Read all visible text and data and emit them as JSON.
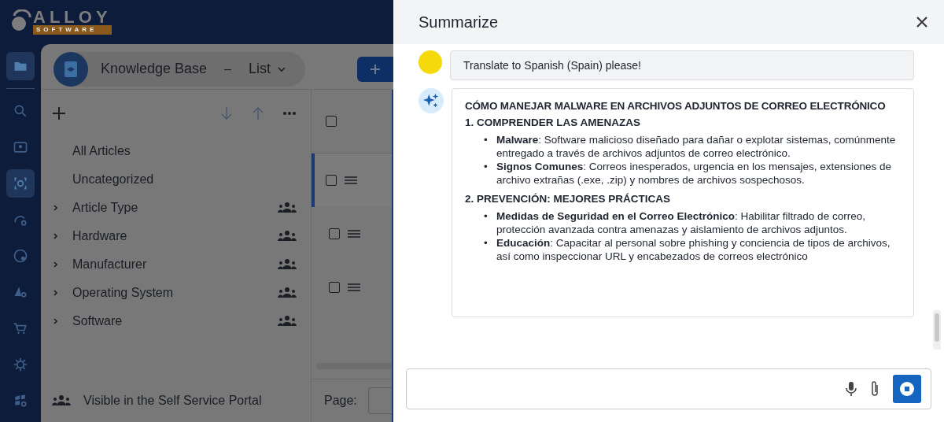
{
  "logo": {
    "word": "ALLOY",
    "tagline": "SOFTWARE"
  },
  "nav": [
    {
      "selected": true
    },
    {
      "selected": false
    },
    {
      "selected": false
    },
    {
      "selected": true
    },
    {
      "selected": false
    },
    {
      "selected": false
    },
    {
      "selected": false
    },
    {
      "selected": false
    },
    {
      "selected": false
    },
    {
      "selected": false
    }
  ],
  "module": {
    "title": "Knowledge Base",
    "separator": "–",
    "view": "List"
  },
  "tree": [
    {
      "kind": "leaf",
      "label": "All Articles"
    },
    {
      "kind": "leaf",
      "label": "Uncategorized"
    },
    {
      "kind": "folder",
      "label": "Article Type",
      "expanded": false
    },
    {
      "kind": "folder",
      "label": "Hardware",
      "expanded": false
    },
    {
      "kind": "folder",
      "label": "Manufacturer",
      "expanded": false
    },
    {
      "kind": "folder",
      "label": "Operating System",
      "expanded": false
    },
    {
      "kind": "folder",
      "label": "Software",
      "expanded": false
    }
  ],
  "legend": "Visible in the Self Service Portal",
  "grid": {
    "select_all_checked": false,
    "rows": [
      {
        "selected": true,
        "checked": false
      },
      {
        "selected": false,
        "checked": false
      },
      {
        "selected": false,
        "checked": false
      }
    ],
    "pager_label": "Page:"
  },
  "dialog": {
    "title": "Summarize",
    "messages": [
      {
        "kind": "user",
        "text": "Translate to Spanish (Spain) please!"
      },
      {
        "kind": "assistant",
        "title": "CÓMO MANEJAR MALWARE EN ARCHIVOS ADJUNTOS DE CORREO ELECTRÓNICO",
        "sections": [
          {
            "heading": "1. COMPRENDER LAS AMENAZAS",
            "bullets": [
              {
                "marker": "•",
                "text": "**Malware**: Software malicioso diseñado para dañar o explotar sistemas, comúnmente entregado a través de archivos adjuntos de correo electrónico."
              },
              {
                "marker": "•",
                "text": "**Signos Comunes**: Correos inesperados, urgencia en los mensajes, extensiones de archivo extrañas (.exe, .zip) y nombres de archivos sospechosos."
              }
            ]
          },
          {
            "heading": "2. PREVENCIÓN: MEJORES PRÁCTICAS",
            "bullets": [
              {
                "marker": "•",
                "text": "**Medidas de Seguridad en el Correo Electrónico**: Habilitar filtrado de correo, protección avanzada contra amenazas y aislamiento de archivos adjuntos."
              },
              {
                "marker": "•",
                "text": "**Educación**: Capacitar al personal sobre phishing y conciencia de tipos de archivos, así como inspeccionar URL y encabezados de correos electrónico"
              }
            ]
          }
        ]
      }
    ]
  }
}
